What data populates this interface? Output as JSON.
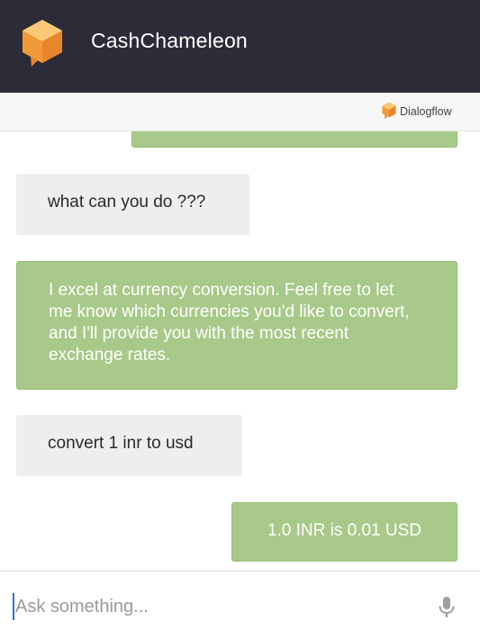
{
  "header": {
    "title": "CashChameleon",
    "logo_icon": "agent-cube-chat-icon",
    "background": "#2b2c37"
  },
  "brandbar": {
    "label": "Dialogflow",
    "icon": "dialogflow-logo-icon"
  },
  "messages": [
    {
      "from": "bot",
      "text": ""
    },
    {
      "from": "user",
      "text": "what can you do ???"
    },
    {
      "from": "bot",
      "text": "I excel at currency conversion. Feel free to let me know which currencies you'd like to convert, and I'll provide you with the most recent exchange rates."
    },
    {
      "from": "user",
      "text": "convert 1 inr to usd"
    },
    {
      "from": "bot",
      "text": "1.0 INR is 0.01 USD"
    }
  ],
  "input": {
    "placeholder": "Ask something...",
    "value": ""
  },
  "mic_icon": "microphone-icon",
  "colors": {
    "bot_bubble": "#a8c989",
    "user_bubble": "#eeeeee",
    "logo_orange": "#f29a38",
    "cursor": "#2f6fe0"
  }
}
